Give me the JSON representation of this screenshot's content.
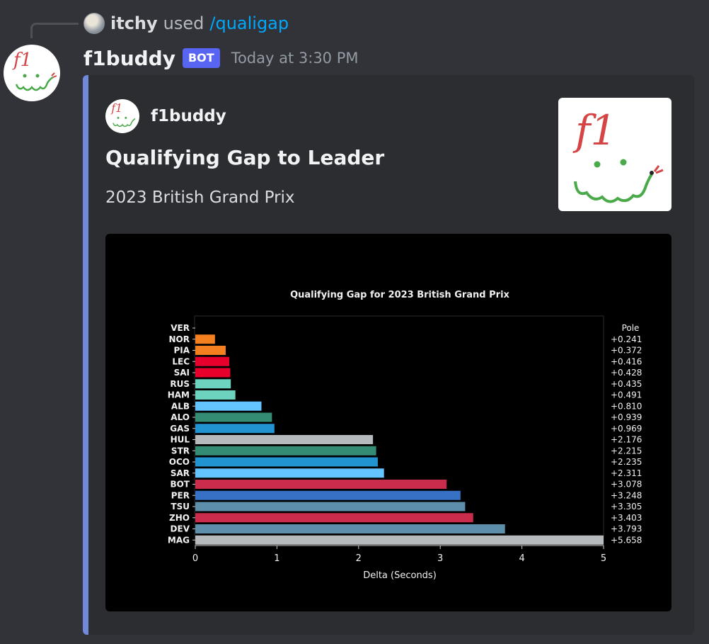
{
  "reply": {
    "user": "itchy",
    "used": "used",
    "command": "/qualigap"
  },
  "message": {
    "author": "f1buddy",
    "badge": "BOT",
    "timestamp": "Today at 3:30 PM"
  },
  "embed": {
    "accent_color": "#7289da",
    "author": "f1buddy",
    "title": "Qualifying Gap to Leader",
    "description": "2023 British Grand Prix",
    "thumbnail_text": "f1"
  },
  "chart_data": {
    "type": "bar",
    "orientation": "horizontal",
    "title": "Qualifying Gap for 2023 British Grand Prix",
    "xlabel": "Delta (Seconds)",
    "ylabel": "",
    "xlim": [
      0,
      5
    ],
    "xticks": [
      0,
      1,
      2,
      3,
      4,
      5
    ],
    "grid": false,
    "categories": [
      "VER",
      "NOR",
      "PIA",
      "LEC",
      "SAI",
      "RUS",
      "HAM",
      "ALB",
      "ALO",
      "GAS",
      "HUL",
      "STR",
      "OCO",
      "SAR",
      "BOT",
      "PER",
      "TSU",
      "ZHO",
      "DEV",
      "MAG"
    ],
    "values": [
      0,
      0.241,
      0.372,
      0.416,
      0.428,
      0.435,
      0.491,
      0.81,
      0.939,
      0.969,
      2.176,
      2.215,
      2.235,
      2.311,
      3.078,
      3.248,
      3.305,
      3.403,
      3.793,
      5.658
    ],
    "value_labels": [
      "Pole",
      "+0.241",
      "+0.372",
      "+0.416",
      "+0.428",
      "+0.435",
      "+0.491",
      "+0.810",
      "+0.939",
      "+0.969",
      "+2.176",
      "+2.215",
      "+2.235",
      "+2.311",
      "+3.078",
      "+3.248",
      "+3.305",
      "+3.403",
      "+3.793",
      "+5.658"
    ],
    "colors": [
      "#3671c6",
      "#f58020",
      "#f58020",
      "#e8002d",
      "#e8002d",
      "#6cd3bf",
      "#6cd3bf",
      "#64c4ff",
      "#358c75",
      "#2293d1",
      "#b6babd",
      "#358c75",
      "#2293d1",
      "#64c4ff",
      "#c92d4b",
      "#3671c6",
      "#5e8faa",
      "#c92d4b",
      "#5e8faa",
      "#b6babd"
    ]
  }
}
